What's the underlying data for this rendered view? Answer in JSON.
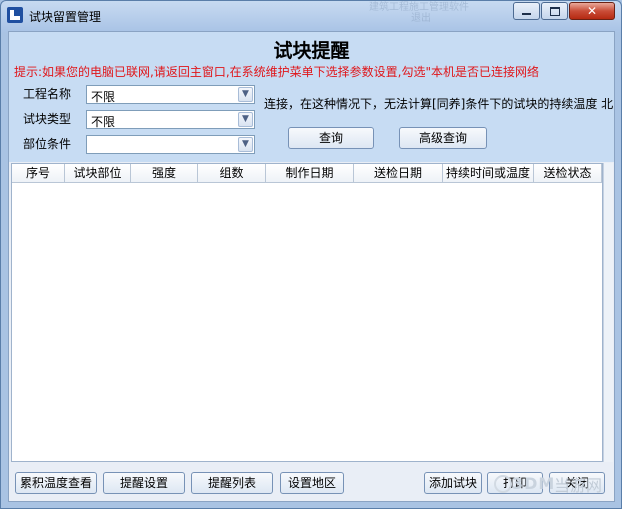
{
  "window": {
    "title": "试块留置管理",
    "ghost_title_line1": "建筑工程施工管理软件",
    "ghost_title_line2": "退出"
  },
  "header": {
    "heading": "试块提醒",
    "tip": "提示:如果您的电脑已联网,请返回主窗口,在系统维护菜单下选择参数设置,勾选\"本机是否已连接网络",
    "note": "连接，在这种情况下，无法计算[同养]条件下的试块的持续温度 北"
  },
  "filters": {
    "project_label": "工程名称",
    "project_value": "不限",
    "type_label": "试块类型",
    "type_value": "不限",
    "location_label": "部位条件",
    "location_value": ""
  },
  "buttons": {
    "query": "查询",
    "advanced_query": "高级查询",
    "accum_temp": "累积温度查看",
    "reminder_settings": "提醒设置",
    "reminder_list": "提醒列表",
    "set_region": "设置地区",
    "add_block": "添加试块",
    "print": "打印",
    "close": "关闭"
  },
  "table": {
    "columns": [
      "序号",
      "试块部位",
      "强度",
      "组数",
      "制作日期",
      "送检日期",
      "持续时间或温度",
      "送检状态"
    ],
    "rows": []
  },
  "watermark": {
    "logo": "3DM",
    "site": "当游网"
  },
  "colors": {
    "tip_text": "#e0161a",
    "header_bg": "#c7dcf3",
    "close_button": "#c94d38"
  }
}
